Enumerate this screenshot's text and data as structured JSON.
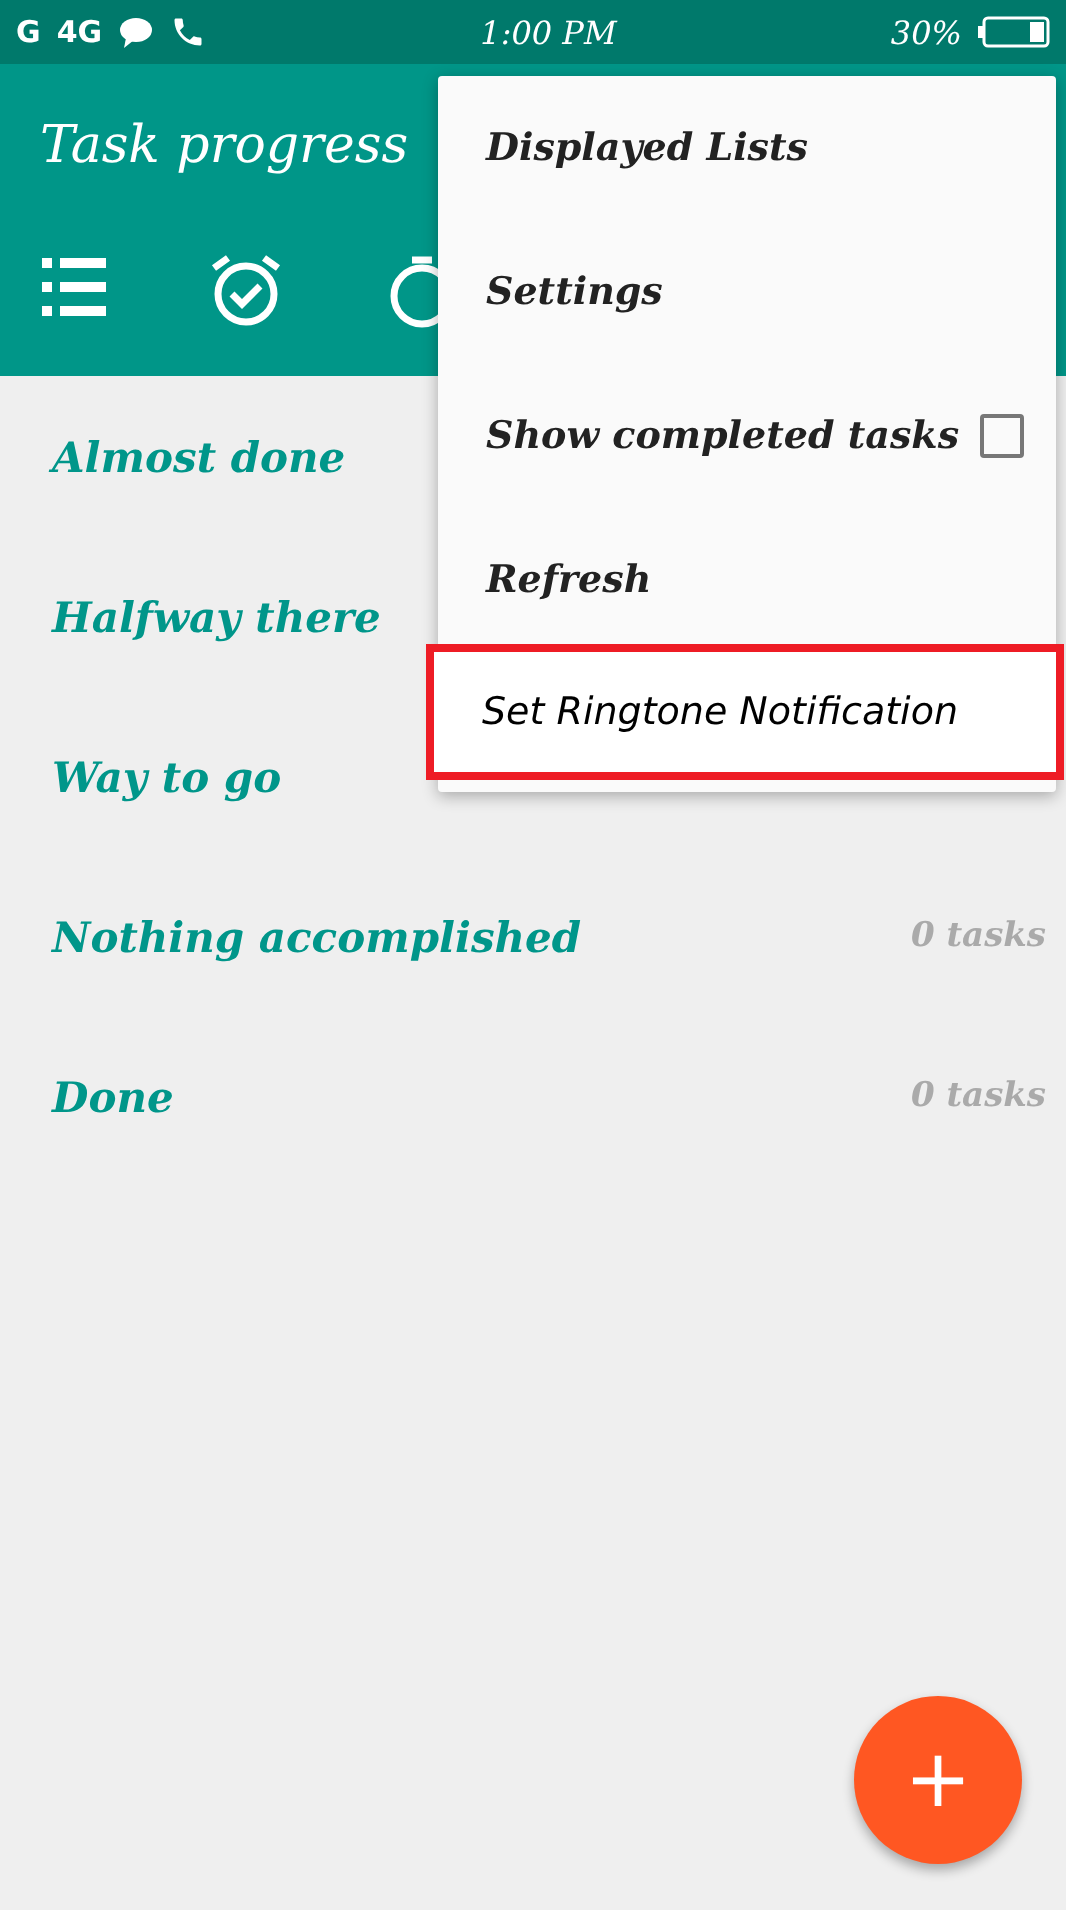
{
  "status_bar": {
    "network_1": "G",
    "network_2": "4G",
    "time": "1:00 PM",
    "battery": "30%"
  },
  "app_bar": {
    "title": "Task progress"
  },
  "lists": [
    {
      "name": "Almost done"
    },
    {
      "name": "Halfway there"
    },
    {
      "name": "Way to go"
    },
    {
      "name": "Nothing accomplished",
      "count": "0 tasks"
    },
    {
      "name": "Done",
      "count": "0 tasks"
    }
  ],
  "menu": [
    {
      "kind": "plain",
      "label": "Displayed Lists"
    },
    {
      "kind": "plain",
      "label": "Settings"
    },
    {
      "kind": "checkbox",
      "label": "Show completed tasks",
      "checked": false
    },
    {
      "kind": "plain",
      "label": "Refresh"
    },
    {
      "kind": "highlighted",
      "label": "Set Ringtone Notification"
    }
  ],
  "fab": {
    "label": "+"
  }
}
